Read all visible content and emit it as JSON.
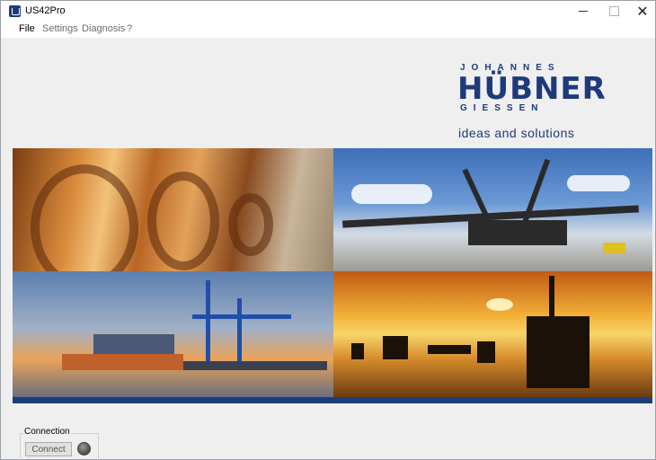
{
  "window": {
    "title": "US42Pro",
    "close_glyph": "✕"
  },
  "menu": {
    "items": [
      "File",
      "Settings",
      "Diagnosis",
      "?"
    ]
  },
  "logo": {
    "top": "JOHANNES",
    "main": "HÜBNER",
    "bottom": "GIESSEN",
    "tagline": "ideas and solutions"
  },
  "images": {
    "steel": "steel-coils-photo",
    "excavator": "bucket-wheel-excavator-photo",
    "port": "container-port-photo",
    "oil": "offshore-oil-rig-sunset-photo"
  },
  "connection": {
    "group_label": "Connection",
    "button_label": "Connect",
    "status_color": "#5a5a5a"
  },
  "colors": {
    "brand_blue": "#1e3a7b",
    "bar_blue": "#1c3f78"
  }
}
